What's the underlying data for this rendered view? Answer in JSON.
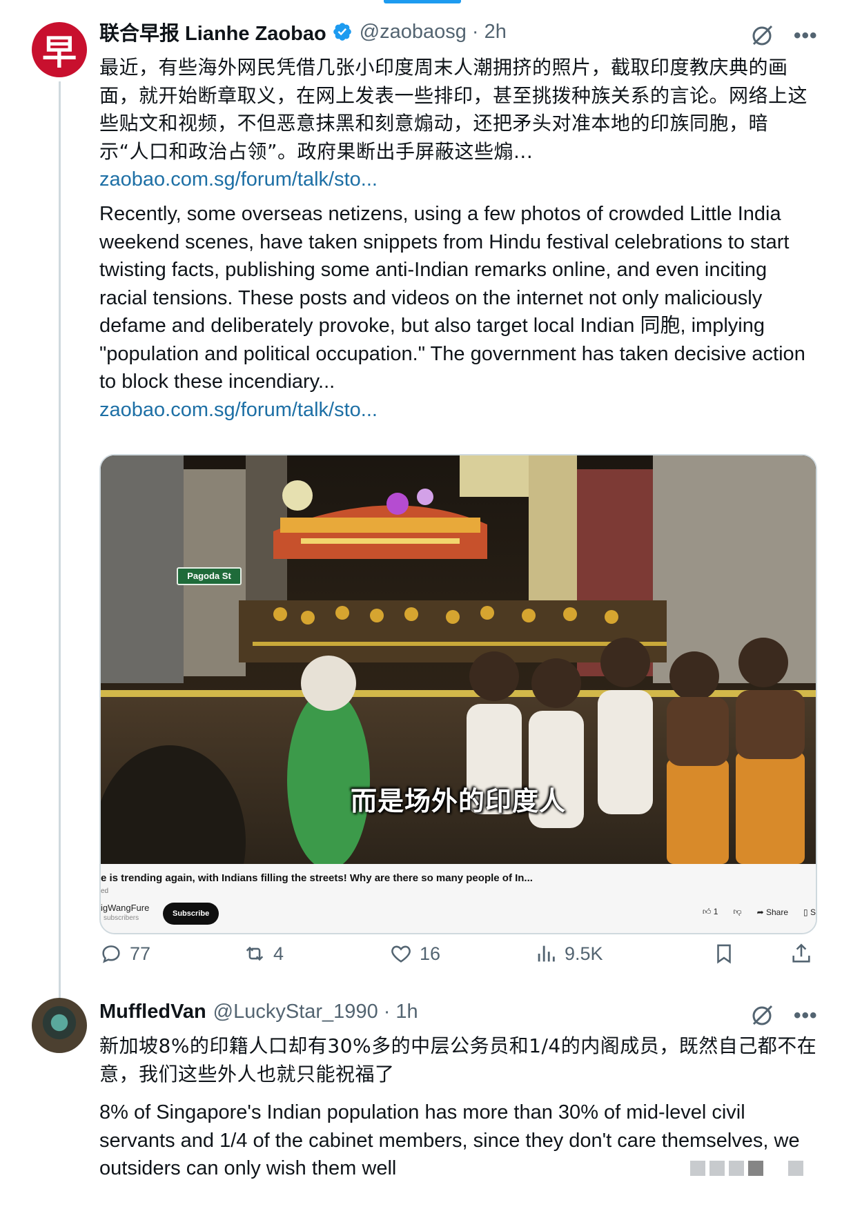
{
  "tweet1": {
    "avatar_text": "早",
    "name": "联合早报 Lianhe Zaobao",
    "handle": "@zaobaosg",
    "time": "2h",
    "zh_text": "最近，有些海外网民凭借几张小印度周末人潮拥挤的照片，截取印度教庆典的画面，就开始断章取义，在网上发表一些排印，甚至挑拨种族关系的言论。网络上这些贴文和视频，不但恶意抹黑和刻意煽动，还把矛头对准本地的印族同胞，暗示“人口和政治占领”。政府果断出手屏蔽这些煽...",
    "link1": "zaobao.com.sg/forum/talk/sto...",
    "en_text": "Recently, some overseas netizens, using a few photos of crowded Little India weekend scenes, have taken snippets from Hindu festival celebrations to start twisting facts, publishing some anti-Indian remarks online, and even inciting racial tensions. These posts and videos on the internet not only maliciously defame and deliberately provoke, but also target local Indian 同胞, implying \"population and political occupation.\" The government has taken decisive action to block these incendiary...",
    "link2": "zaobao.com.sg/forum/talk/sto...",
    "video": {
      "subtitle": "而是场外的印度人",
      "street_sign": "Pagoda St",
      "title": "e is trending again, with Indians filling the streets! Why are there so many people of In...",
      "sub": "ed",
      "channel": "igWangFure",
      "subscribers": "subscribers",
      "subscribe": "Subscribe",
      "likes": "1",
      "share": "Share",
      "save": "S"
    },
    "stats": {
      "replies": "77",
      "retweets": "4",
      "likes": "16",
      "views": "9.5K"
    }
  },
  "tweet2": {
    "name": "MuffledVan",
    "handle": "@LuckyStar_1990",
    "time": "1h",
    "zh_text": "新加坡8%的印籍人口却有30%多的中层公务员和1/4的内阁成员，既然自己都不在意，我们这些外人也就只能祝福了",
    "en_text": "8% of Singapore's Indian population has more than 30% of mid-level civil servants and 1/4 of the cabinet members, since they don't care themselves, we outsiders can only wish them well"
  },
  "separator": "·",
  "colors": {
    "link": "#1d6fa5",
    "verified": "#1d9bf0",
    "muted": "#536471",
    "zaobao_red": "#c8102e"
  }
}
